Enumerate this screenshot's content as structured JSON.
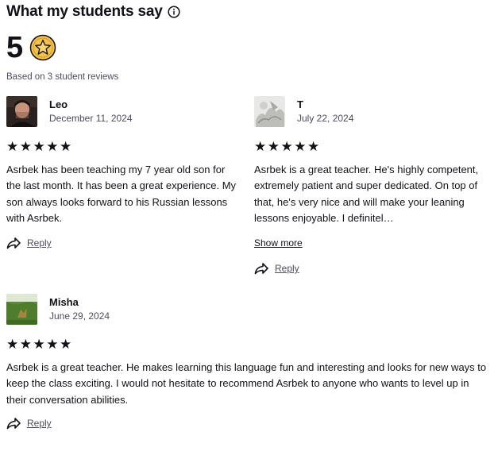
{
  "header": {
    "title": "What my students say",
    "rating": "5",
    "based_on": "Based on 3 student reviews"
  },
  "reviews": [
    {
      "name": "Leo",
      "date": "December 11, 2024",
      "stars": "★★★★★",
      "text": "Asrbek has been teaching my 7 year old son for the last month. It has been a great experience. My son always looks forward to his Russian lessons with Asrbek.",
      "reply_label": "Reply"
    },
    {
      "name": "T",
      "date": "July 22, 2024",
      "stars": "★★★★★",
      "text": "Asrbek is a great teacher. He's highly competent, extremely patient and super dedicated. On top of that, he's very nice and will make your leaning lessons enjoyable. I definitel…",
      "show_more": "Show more",
      "reply_label": "Reply"
    },
    {
      "name": "Misha",
      "date": "June 29, 2024",
      "stars": "★★★★★",
      "text": "Asrbek is a great teacher. He makes learning this language fun and interesting and looks for new ways to keep the class exciting. I would not hesitate to recommend Asrbek to anyone who wants to level up in their conversation abilities.",
      "reply_label": "Reply"
    }
  ]
}
